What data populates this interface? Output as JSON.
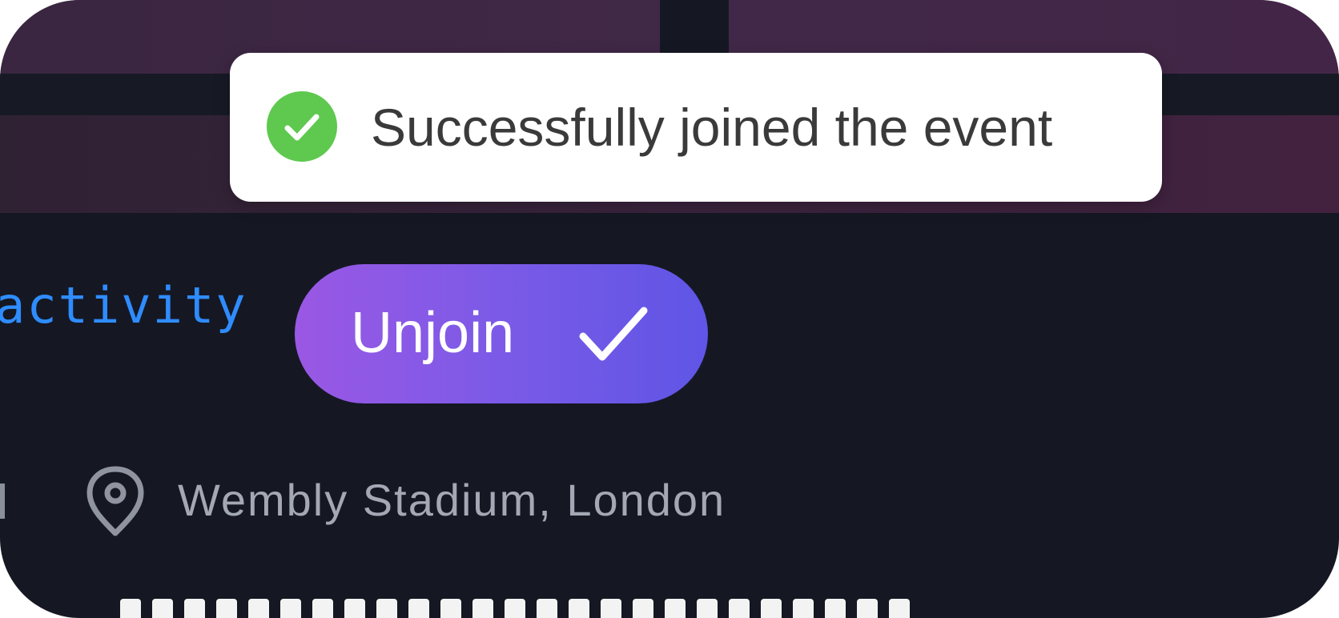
{
  "toast": {
    "message": "Successfully joined the event",
    "icon": "check-circle-icon",
    "status_color": "#5ec94e"
  },
  "event": {
    "activity_link": "activity",
    "join_button": {
      "label": "Unjoin",
      "icon": "checkmark-icon",
      "gradient": [
        "#9a58e4",
        "#5f55e6"
      ]
    },
    "location": {
      "icon": "location-pin-icon",
      "text": "Wembly Stadium, London"
    }
  },
  "theme": {
    "background": "#151823",
    "link_color": "#2f8cff"
  }
}
